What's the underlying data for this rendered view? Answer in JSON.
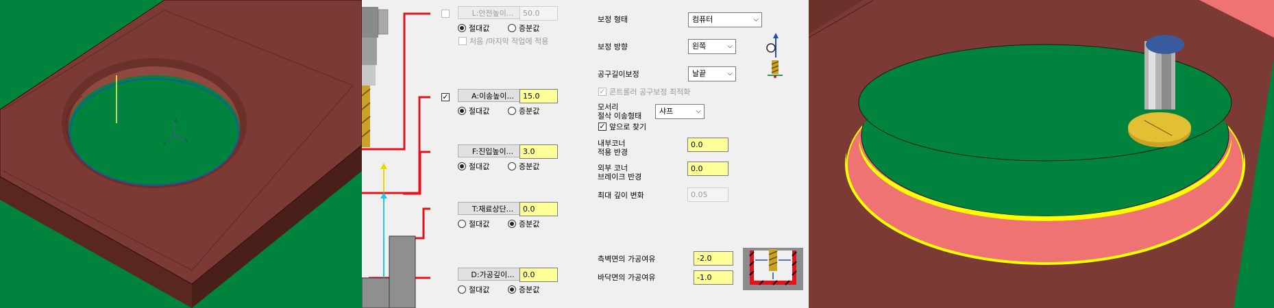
{
  "top_height": {
    "L": {
      "button_label": "L:안전높이...",
      "value": "50.0",
      "absolute_label": "절대값",
      "incremental_label": "증분값",
      "selected": "absolute",
      "enabled": false
    },
    "first_last_checkbox_label": "처음 /마지막 작업에 적용",
    "A": {
      "button_label": "A:이송높이...",
      "value": "15.0",
      "absolute_label": "절대값",
      "incremental_label": "증분값",
      "selected": "absolute",
      "enabled": true
    },
    "F": {
      "button_label": "F:진입높이...",
      "value": "3.0",
      "absolute_label": "절대값",
      "incremental_label": "증분값",
      "selected": "absolute"
    },
    "T": {
      "button_label": "T:재료상단...",
      "value": "0.0",
      "absolute_label": "절대값",
      "incremental_label": "증분값",
      "selected": "incremental"
    },
    "D": {
      "button_label": "D:가공깊이...",
      "value": "0.0",
      "absolute_label": "절대값",
      "incremental_label": "증분값",
      "selected": "incremental"
    }
  },
  "compensation": {
    "type_label": "보정 형태",
    "type_value": "컴퓨터",
    "direction_label": "보정 방향",
    "direction_value": "왼쪽",
    "length_label": "공구길이보정",
    "length_value": "날끝",
    "optimize_label": "콘트롤러 공구보정 최적화",
    "corner_label_line1": "모서리",
    "corner_label_line2": "절삭 이송형태",
    "corner_value": "샤프",
    "look_ahead_label": "앞으로 찾기",
    "inner_corner_label_line1": "내부코너",
    "inner_corner_label_line2": "적용 반경",
    "inner_corner_value": "0.0",
    "outer_corner_label_line1": "외부 코너",
    "outer_corner_label_line2": "브레이크 반경",
    "outer_corner_value": "0.0",
    "max_depth_label": "최대 깊이 변화",
    "max_depth_value": "0.05"
  },
  "stock": {
    "wall_label": "측벽면의 가공여유",
    "wall_value": "-2.0",
    "floor_label": "바닥면의 가공여유",
    "floor_value": "-1.0"
  },
  "colors": {
    "viewport_bg": "#00843d",
    "part_top": "#7b3a33",
    "highlight_wall": "#f07373",
    "input_yellow": "#ffff99",
    "guide_red": "#e0141c"
  }
}
